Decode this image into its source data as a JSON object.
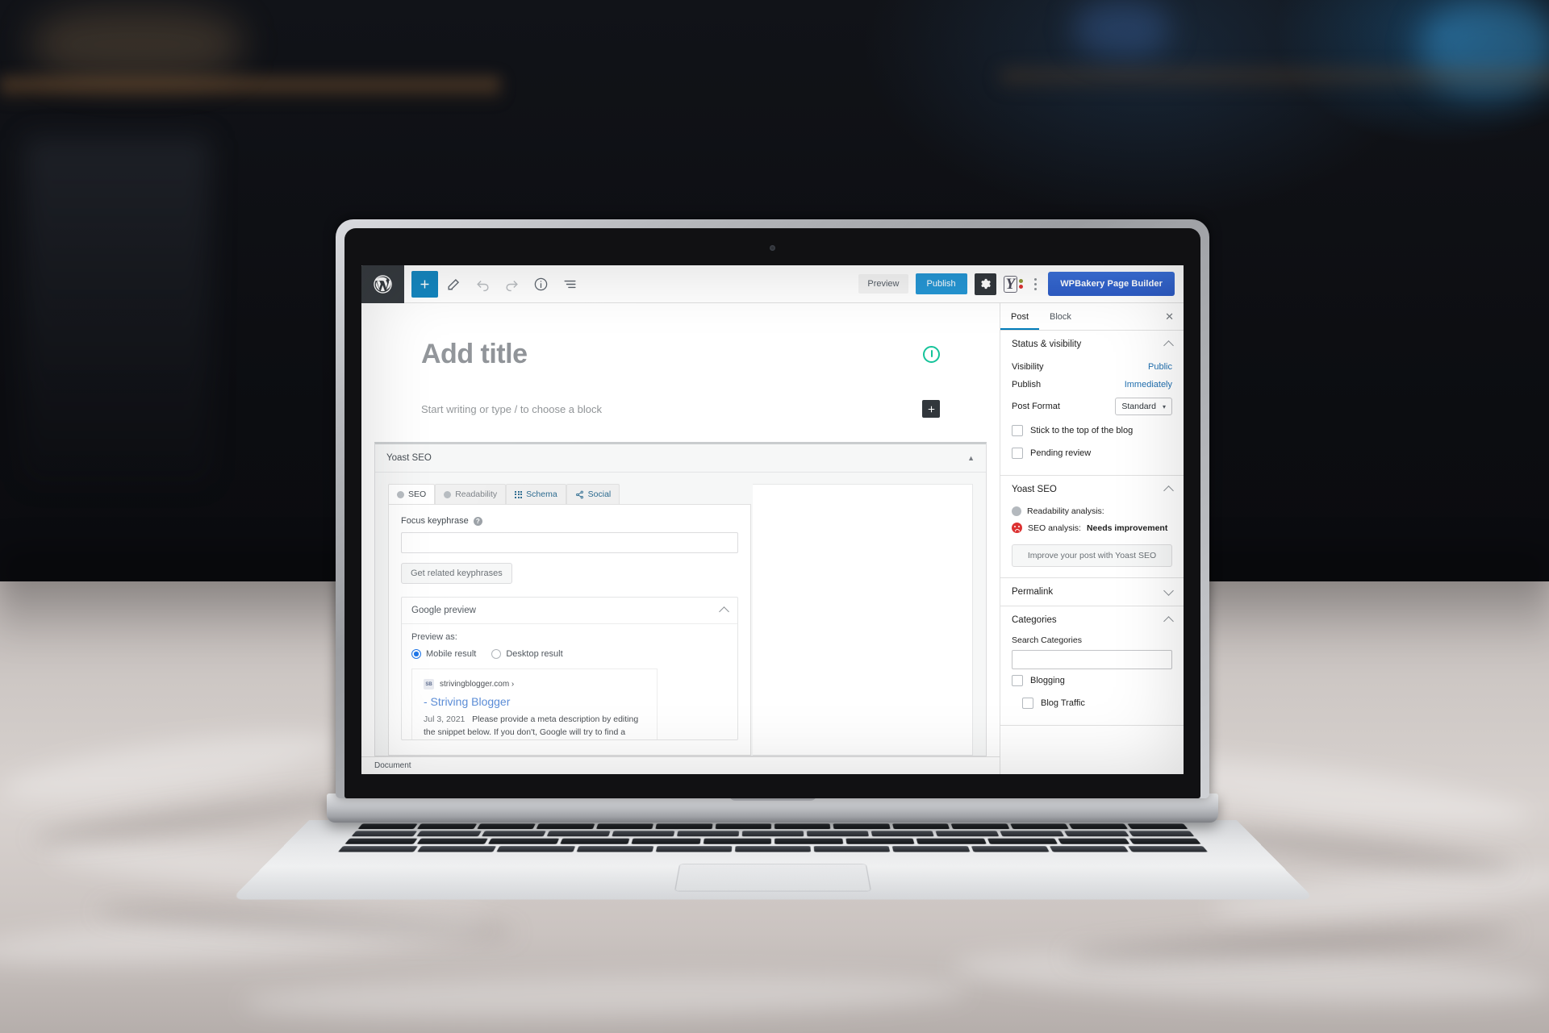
{
  "toolbar": {
    "logo_icon": "wordpress-logo-icon",
    "add_block_label": "+",
    "preview_label": "Preview",
    "publish_label": "Publish",
    "settings_icon": "gear-icon",
    "yoast_icon": "yoast-seo-icon",
    "options_icon": "kebab-menu-icon",
    "wpbakery_label": "WPBakery Page Builder",
    "icons": [
      "add-block-icon",
      "edit-pencil-icon",
      "undo-icon",
      "redo-icon",
      "info-icon",
      "list-view-icon"
    ]
  },
  "editor": {
    "title_placeholder": "Add title",
    "paragraph_placeholder": "Start writing or type / to choose a block",
    "grammarly_icon": "grammarly-icon",
    "block_inserter_icon": "plus-icon"
  },
  "metabox": {
    "title": "Yoast SEO",
    "collapse_icon": "collapse-triangle-icon",
    "tabs": [
      {
        "label": "SEO",
        "icon": "seo-bullet-icon",
        "active": true
      },
      {
        "label": "Readability",
        "icon": "readability-bullet-icon",
        "active": false
      },
      {
        "label": "Schema",
        "icon": "schema-grid-icon",
        "active": false
      },
      {
        "label": "Social",
        "icon": "social-share-icon",
        "active": false
      }
    ],
    "focus_keyphrase_label": "Focus keyphrase",
    "focus_keyphrase_help_icon": "help-icon",
    "focus_keyphrase_value": "",
    "get_related_label": "Get related keyphrases",
    "google_preview": {
      "title": "Google preview",
      "chevron_icon": "chevron-up-icon",
      "preview_as_label": "Preview as:",
      "options": [
        {
          "label": "Mobile result",
          "selected": true
        },
        {
          "label": "Desktop result",
          "selected": false
        }
      ],
      "snippet": {
        "favicon_text": "SB",
        "domain": "strivingblogger.com ›",
        "title": "- Striving Blogger",
        "date": "Jul 3, 2021",
        "description": "Please provide a meta description by editing the snippet below. If you don't, Google will try to find a"
      }
    }
  },
  "statusbar": {
    "label": "Document"
  },
  "sidebar": {
    "tabs": [
      {
        "label": "Post",
        "active": true
      },
      {
        "label": "Block",
        "active": false
      }
    ],
    "close_icon": "close-icon",
    "sections": [
      {
        "name": "status-visibility",
        "title": "Status & visibility",
        "chevron_icon": "chevron-up-icon",
        "rows": [
          {
            "label": "Visibility",
            "value": "Public"
          },
          {
            "label": "Publish",
            "value": "Immediately"
          }
        ],
        "post_format_label": "Post Format",
        "post_format_value": "Standard",
        "post_format_caret_icon": "chevron-down-icon",
        "checkboxes": [
          {
            "label": "Stick to the top of the blog",
            "checked": false
          },
          {
            "label": "Pending review",
            "checked": false
          }
        ]
      },
      {
        "name": "yoast-seo",
        "title": "Yoast SEO",
        "chevron_icon": "chevron-up-icon",
        "readability_label": "Readability analysis:",
        "readability_icon": "gray-bullet-icon",
        "seo_label": "SEO analysis:",
        "seo_value": "Needs improvement",
        "seo_icon": "red-sad-face-icon",
        "improve_label": "Improve your post with Yoast SEO"
      },
      {
        "name": "permalink",
        "title": "Permalink",
        "chevron_icon": "chevron-down-icon"
      },
      {
        "name": "categories",
        "title": "Categories",
        "chevron_icon": "chevron-up-icon",
        "search_label": "Search Categories",
        "search_value": "",
        "items": [
          {
            "label": "Blogging",
            "checked": false,
            "indent": false
          },
          {
            "label": "Blog Traffic",
            "checked": false,
            "indent": true
          }
        ]
      }
    ]
  },
  "colors": {
    "wp_blue": "#007cba",
    "publish_blue": "#2596d4",
    "wpbakery_blue": "#3a6fd8",
    "link_blue": "#2271b1",
    "grammarly_green": "#15c39a",
    "error_red": "#dc3232",
    "admin_dark": "#23282d"
  }
}
